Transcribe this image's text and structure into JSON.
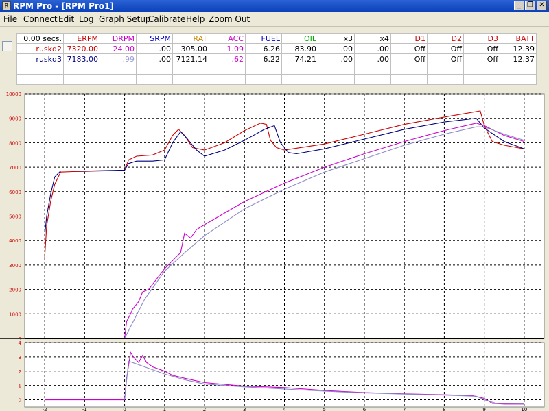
{
  "window": {
    "title": "RPM Pro - [RPM Pro1]",
    "icon_label": "R",
    "controls": [
      {
        "name": "minimize-button",
        "glyph": "_"
      },
      {
        "name": "restore-button",
        "glyph": "❐"
      },
      {
        "name": "close-button",
        "glyph": "✕"
      }
    ]
  },
  "menu": {
    "items": [
      "File",
      "Connect",
      "Edit",
      "Log",
      "Graph Setup",
      "Calibrate",
      "Help",
      "Zoom Out"
    ]
  },
  "readout": {
    "time_label": "0.00 secs.",
    "columns": [
      {
        "label": "ERPM",
        "color": "#cc0000"
      },
      {
        "label": "DRPM",
        "color": "#cc00cc"
      },
      {
        "label": "SRPM",
        "color": "#0000cc"
      },
      {
        "label": "RAT",
        "color": "#cc8800"
      },
      {
        "label": "ACC",
        "color": "#cc00cc"
      },
      {
        "label": "FUEL",
        "color": "#0000cc"
      },
      {
        "label": "OIL",
        "color": "#00aa00"
      },
      {
        "label": "x3",
        "color": "#000000"
      },
      {
        "label": "x4",
        "color": "#000000"
      },
      {
        "label": "D1",
        "color": "#cc0000"
      },
      {
        "label": "D2",
        "color": "#cc0000"
      },
      {
        "label": "D3",
        "color": "#cc0000"
      },
      {
        "label": "BATT",
        "color": "#cc0000"
      }
    ],
    "rows": [
      {
        "name": "ruskq2",
        "name_color": "#cc0000",
        "color": "#cc0000",
        "drpm_color": "#cc00cc",
        "acc_color": "#cc00cc",
        "values": [
          "7320.00",
          "24.00",
          ".00",
          "305.00",
          "1.09",
          "6.26",
          "83.90",
          ".00",
          ".00",
          "Off",
          "Off",
          "Off",
          "12.39"
        ]
      },
      {
        "name": "ruskq3",
        "name_color": "#000080",
        "color": "#000080",
        "drpm_color": "#9b9bd8",
        "acc_color": "#cc00cc",
        "values": [
          "7183.00",
          ".99",
          ".00",
          "7121.14",
          ".62",
          "6.22",
          "74.21",
          ".00",
          ".00",
          "Off",
          "Off",
          "Off",
          "12.37"
        ]
      }
    ],
    "empty_rows": 2
  },
  "chart_data": {
    "type": "line",
    "x_ticks": [
      "-2",
      "-1",
      "0",
      "1",
      "2",
      "3",
      "4",
      "5",
      "6",
      "7",
      "8",
      "9",
      "10"
    ],
    "xlim": [
      -2.5,
      10.5
    ],
    "grid": true,
    "panels": [
      {
        "name": "rpm-panel",
        "ylim": [
          0,
          10000
        ],
        "y_ticks": [
          "0",
          "1000",
          "2000",
          "3000",
          "4000",
          "5000",
          "6000",
          "7000",
          "8000",
          "9000",
          "10000"
        ],
        "series": [
          {
            "color": "#cc0000",
            "points": [
              [
                -2,
                3300
              ],
              [
                -1.95,
                4600
              ],
              [
                -1.85,
                5600
              ],
              [
                -1.75,
                6300
              ],
              [
                -1.6,
                6800
              ],
              [
                -1.3,
                6820
              ],
              [
                -1,
                6830
              ],
              [
                -0.5,
                6850
              ],
              [
                0,
                6880
              ],
              [
                0.1,
                7300
              ],
              [
                0.3,
                7450
              ],
              [
                0.7,
                7500
              ],
              [
                1,
                7700
              ],
              [
                1.2,
                8300
              ],
              [
                1.35,
                8550
              ],
              [
                1.5,
                8300
              ],
              [
                1.7,
                7800
              ],
              [
                2,
                7700
              ],
              [
                2.5,
                8000
              ],
              [
                3,
                8500
              ],
              [
                3.4,
                8800
              ],
              [
                3.55,
                8750
              ],
              [
                3.65,
                8100
              ],
              [
                3.8,
                7800
              ],
              [
                4,
                7700
              ],
              [
                5,
                7950
              ],
              [
                6,
                8350
              ],
              [
                7,
                8750
              ],
              [
                8,
                9050
              ],
              [
                8.9,
                9300
              ],
              [
                9,
                8700
              ],
              [
                9.2,
                8050
              ],
              [
                9.5,
                7900
              ],
              [
                10,
                7750
              ]
            ]
          },
          {
            "color": "#000080",
            "points": [
              [
                -2,
                4200
              ],
              [
                -1.95,
                5000
              ],
              [
                -1.85,
                5900
              ],
              [
                -1.75,
                6600
              ],
              [
                -1.6,
                6850
              ],
              [
                -1.3,
                6850
              ],
              [
                -1,
                6840
              ],
              [
                -0.5,
                6860
              ],
              [
                0,
                6880
              ],
              [
                0.1,
                7150
              ],
              [
                0.3,
                7250
              ],
              [
                0.7,
                7250
              ],
              [
                1,
                7300
              ],
              [
                1.2,
                8000
              ],
              [
                1.4,
                8450
              ],
              [
                1.55,
                8200
              ],
              [
                1.8,
                7700
              ],
              [
                2,
                7450
              ],
              [
                2.5,
                7700
              ],
              [
                3,
                8100
              ],
              [
                3.5,
                8550
              ],
              [
                3.75,
                8700
              ],
              [
                3.9,
                8000
              ],
              [
                4.1,
                7600
              ],
              [
                4.3,
                7550
              ],
              [
                5,
                7750
              ],
              [
                6,
                8150
              ],
              [
                7,
                8550
              ],
              [
                8,
                8850
              ],
              [
                8.8,
                9000
              ],
              [
                9,
                8600
              ],
              [
                9.5,
                8050
              ],
              [
                10,
                7750
              ]
            ]
          },
          {
            "color": "#cc00cc",
            "points": [
              [
                0,
                0
              ],
              [
                0.05,
                700
              ],
              [
                0.15,
                1000
              ],
              [
                0.2,
                1200
              ],
              [
                0.35,
                1500
              ],
              [
                0.45,
                1900
              ],
              [
                0.6,
                2000
              ],
              [
                1,
                2850
              ],
              [
                1.3,
                3350
              ],
              [
                1.4,
                3500
              ],
              [
                1.5,
                4300
              ],
              [
                1.65,
                4100
              ],
              [
                1.8,
                4450
              ],
              [
                2,
                4650
              ],
              [
                3,
                5600
              ],
              [
                4,
                6350
              ],
              [
                5,
                7000
              ],
              [
                6,
                7550
              ],
              [
                7,
                8050
              ],
              [
                8,
                8500
              ],
              [
                8.8,
                8800
              ],
              [
                9,
                8700
              ],
              [
                9.5,
                8300
              ],
              [
                10,
                8050
              ]
            ]
          },
          {
            "color": "#8a8ac8",
            "points": [
              [
                0,
                0
              ],
              [
                0.5,
                1600
              ],
              [
                1,
                2750
              ],
              [
                1.5,
                3500
              ],
              [
                2,
                4200
              ],
              [
                3,
                5300
              ],
              [
                4,
                6100
              ],
              [
                5,
                6800
              ],
              [
                6,
                7350
              ],
              [
                7,
                7900
              ],
              [
                8,
                8350
              ],
              [
                8.8,
                8650
              ],
              [
                9,
                8650
              ],
              [
                9.5,
                8350
              ],
              [
                10,
                8100
              ]
            ]
          }
        ]
      },
      {
        "name": "acc-panel",
        "ylim": [
          -0.5,
          4
        ],
        "y_ticks": [
          "0",
          "1",
          "2",
          "3",
          "4"
        ],
        "series": [
          {
            "color": "#cc00cc",
            "points": [
              [
                -2,
                0
              ],
              [
                0,
                0
              ],
              [
                0.05,
                1.5
              ],
              [
                0.15,
                3.3
              ],
              [
                0.25,
                2.9
              ],
              [
                0.35,
                2.6
              ],
              [
                0.45,
                3.1
              ],
              [
                0.55,
                2.6
              ],
              [
                0.7,
                2.3
              ],
              [
                1,
                2.0
              ],
              [
                1.2,
                1.7
              ],
              [
                1.5,
                1.5
              ],
              [
                2,
                1.2
              ],
              [
                3,
                0.95
              ],
              [
                4,
                0.85
              ],
              [
                5,
                0.65
              ],
              [
                6,
                0.5
              ],
              [
                7,
                0.42
              ],
              [
                8,
                0.35
              ],
              [
                8.7,
                0.3
              ],
              [
                9,
                0.1
              ],
              [
                9.2,
                -0.25
              ],
              [
                9.5,
                -0.3
              ],
              [
                10,
                -0.3
              ]
            ]
          },
          {
            "color": "#8a8ac8",
            "points": [
              [
                0,
                0
              ],
              [
                0.1,
                2.7
              ],
              [
                0.3,
                2.5
              ],
              [
                0.6,
                2.2
              ],
              [
                1,
                1.8
              ],
              [
                1.5,
                1.4
              ],
              [
                2,
                1.1
              ],
              [
                3,
                0.9
              ],
              [
                4,
                0.75
              ],
              [
                5,
                0.6
              ],
              [
                6,
                0.48
              ],
              [
                7,
                0.4
              ],
              [
                8,
                0.33
              ],
              [
                8.8,
                0.25
              ],
              [
                9,
                0
              ],
              [
                9.3,
                -0.25
              ],
              [
                10,
                -0.28
              ]
            ]
          }
        ]
      }
    ]
  }
}
